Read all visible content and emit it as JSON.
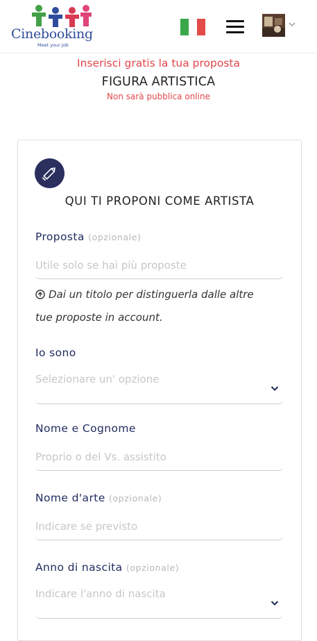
{
  "header": {
    "logo": {
      "brand": "Cinebooking",
      "tagline": "Meet your Job"
    },
    "language_flag": "italian-flag-icon",
    "menu_icon": "hamburger-menu-icon",
    "account_icon": "user-avatar"
  },
  "intro": {
    "line1": "Inserisci gratis la tua proposta",
    "line2": "FIGURA ARTISTICA",
    "line3": "Non sarà pubblica online"
  },
  "form": {
    "icon": "pencil-icon",
    "title": "QUI TI PROPONI COME ARTISTA",
    "proposta": {
      "label": "Proposta",
      "optional": "(opzionale)",
      "placeholder": "Utile solo se hai più proposte"
    },
    "hint": {
      "line1": "Dai un titolo per distinguerla dalle altre",
      "line2": "tue proposte in account."
    },
    "io_sono": {
      "label": "Io sono",
      "placeholder": "Selezionare un' opzione"
    },
    "nome_cognome": {
      "label": "Nome e Cognome",
      "placeholder": "Proprio o del Vs. assistito"
    },
    "nome_arte": {
      "label": "Nome d'arte",
      "optional": "(opzionale)",
      "placeholder": "Indicare se previsto"
    },
    "anno_nascita": {
      "label": "Anno di nascita",
      "optional": "(opzionale)",
      "placeholder": "Indicare l'anno di nascita"
    }
  },
  "colors": {
    "brand_blue": "#2f4d9c",
    "accent_red": "#e0464a",
    "label_navy": "#1f2a5e",
    "flag_green": "#3aa84a",
    "flag_white": "#ffffff",
    "flag_red": "#e34a4a"
  }
}
